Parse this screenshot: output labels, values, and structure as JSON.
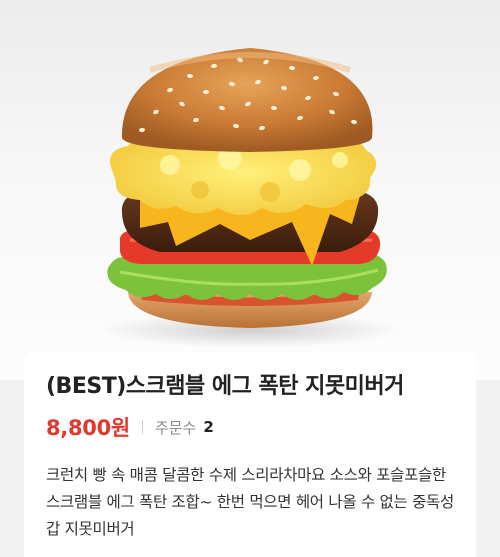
{
  "product": {
    "title": "(BEST)스크램블 에그 폭탄 지못미버거",
    "price": "8,800원",
    "orders_label": "주문수",
    "orders_count": "2",
    "description": "크런치 빵 속 매콤 달콤한 수제 스리라차마요 소스와 포슬포슬한 스크램블 에그 폭탄 조합~ 한번 먹으면 헤어 나올 수 없는 중독성 갑 지못미버거"
  },
  "colors": {
    "price": "#e03a2f",
    "title": "#222222",
    "background": "#f2f2f2"
  }
}
